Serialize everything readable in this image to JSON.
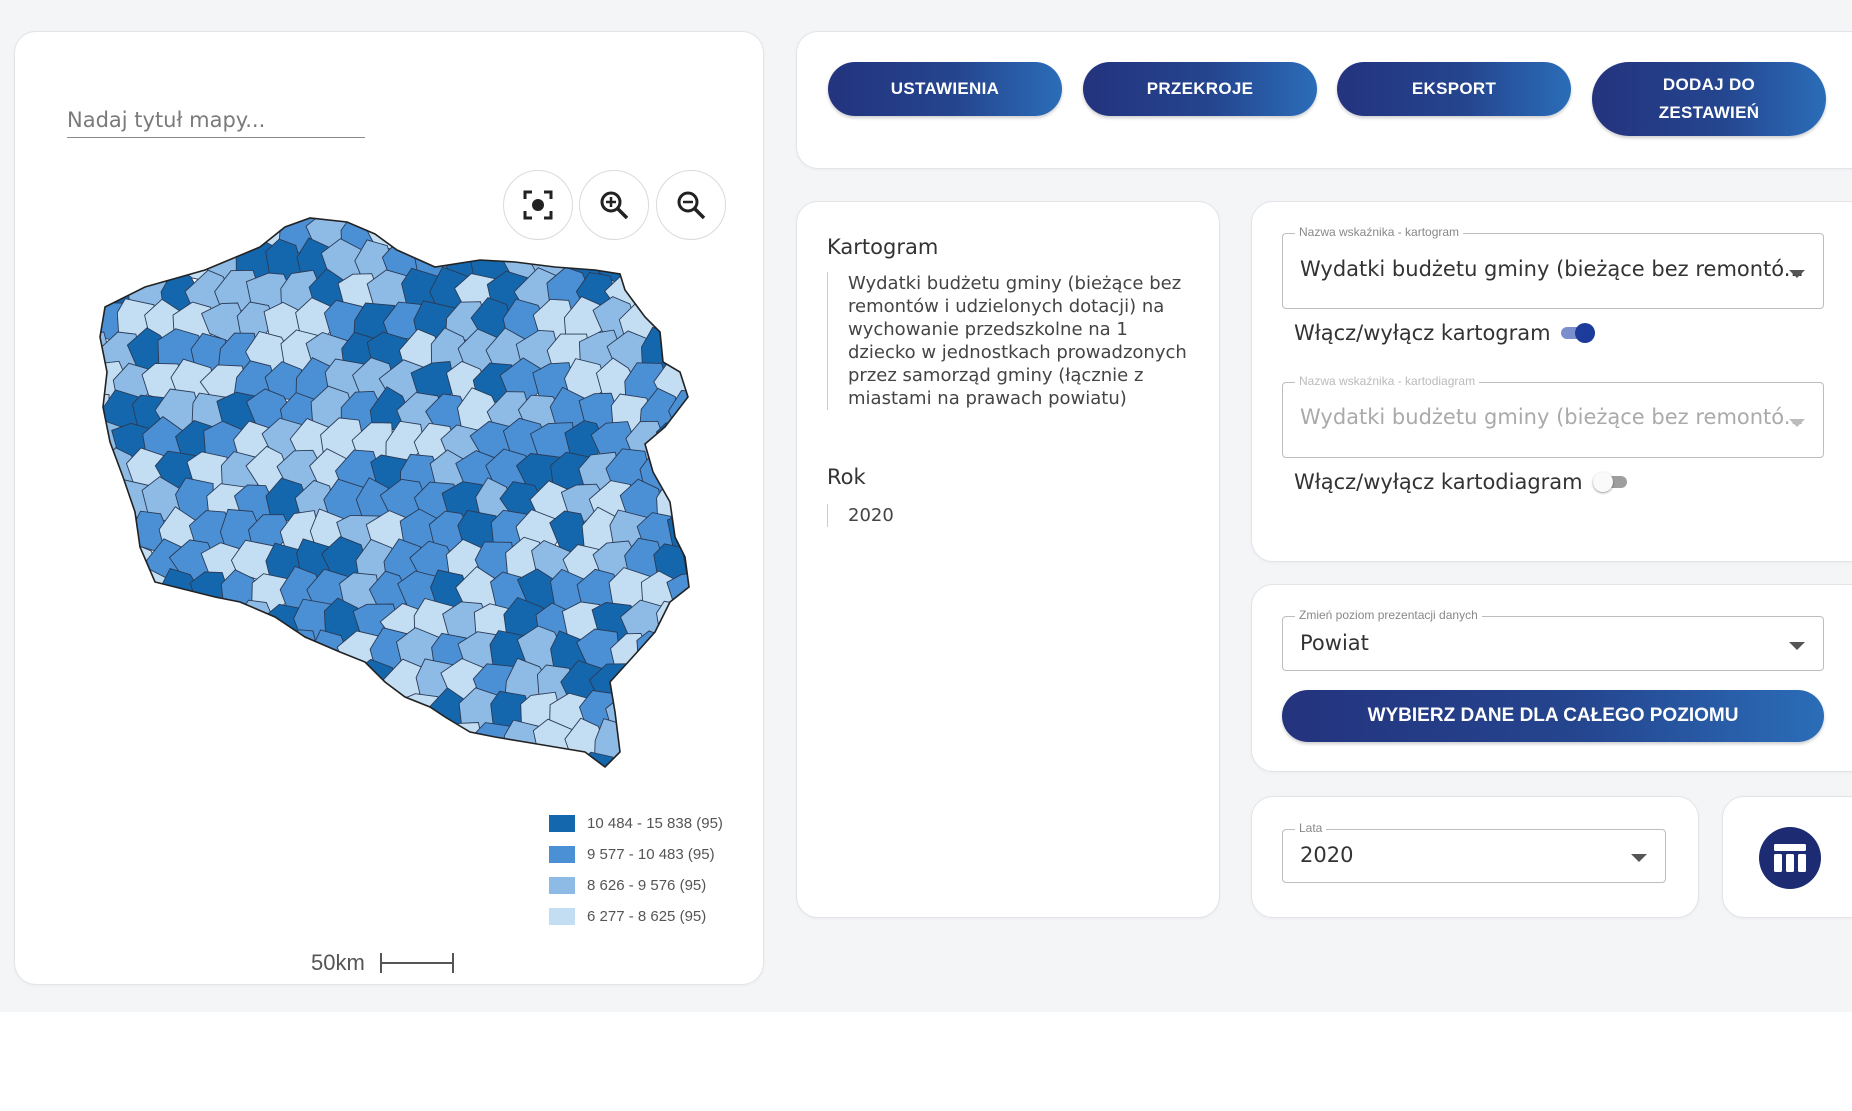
{
  "map": {
    "title_placeholder": "Nadaj tytuł mapy...",
    "controls": [
      "center-icon",
      "zoom-in-icon",
      "zoom-out-icon"
    ],
    "legend": [
      {
        "label": "10 484 - 15 838 (95)",
        "color": "#1567ad"
      },
      {
        "label": "9 577 - 10 483 (95)",
        "color": "#4b8fd4"
      },
      {
        "label": "8 626 - 9 576 (95)",
        "color": "#8dbbe6"
      },
      {
        "label": "6 277 - 8 625 (95)",
        "color": "#c3ddf3"
      }
    ],
    "scale_label": "50km"
  },
  "toolbar": {
    "settings_label": "USTAWIENIA",
    "sections_label": "PRZEKROJE",
    "export_label": "EKSPORT",
    "add_label": "DODAJ DO\nZESTAWIEŃ"
  },
  "info": {
    "kartogram_heading": "Kartogram",
    "kartogram_text": "Wydatki budżetu gminy (bieżące bez remontów i udzielonych dotacji) na wychowanie przedszkolne na 1 dziecko w jednostkach prowadzonych przez samorząd gminy (łącznie z miastami na prawach powiatu)",
    "year_heading": "Rok",
    "year_value": "2020"
  },
  "indicator": {
    "kartogram_field_label": "Nazwa wskaźnika - kartogram",
    "kartogram_field_value": "Wydatki budżetu gminy (bieżące bez remontó...",
    "kartogram_toggle_label": "Włącz/wyłącz kartogram",
    "kartogram_toggle_on": true,
    "kartodiagram_field_label": "Nazwa wskaźnika - kartodiagram",
    "kartodiagram_field_value": "Wydatki budżetu gminy (bieżące bez remontó...",
    "kartodiagram_toggle_label": "Włącz/wyłącz kartodiagram",
    "kartodiagram_toggle_on": false
  },
  "level": {
    "field_label": "Zmień poziom prezentacji danych",
    "field_value": "Powiat",
    "select_all_label": "WYBIERZ DANE DLA CAŁEGO POZIOMU"
  },
  "years": {
    "field_label": "Lata",
    "field_value": "2020"
  },
  "colors": {
    "primary": "#24337e",
    "accent": "#2b6db8",
    "toggle_on": "#1d3b9a"
  }
}
